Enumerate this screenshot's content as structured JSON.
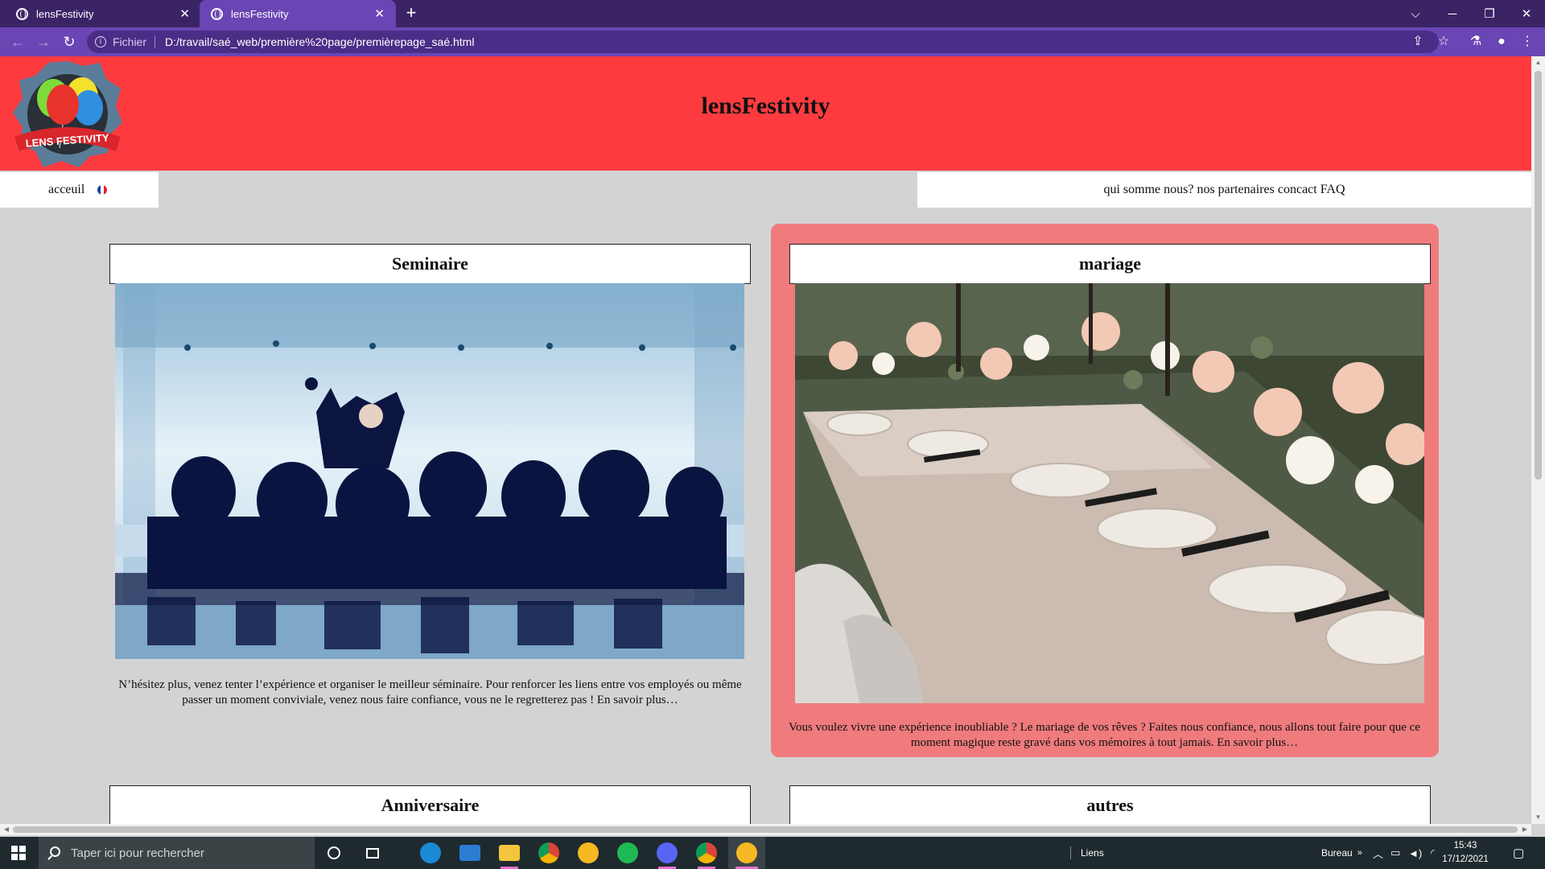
{
  "browser": {
    "tabs": [
      {
        "title": "lensFestivity",
        "active": false
      },
      {
        "title": "lensFestivity",
        "active": true
      }
    ],
    "new_tab": "+",
    "address": {
      "scheme_label": "Fichier",
      "url": "D:/travail/saé_web/première%20page/premièrepage_saé.html"
    }
  },
  "site": {
    "title": "lensFestivity",
    "logo_text": "LENS FESTIVITY",
    "nav_left": {
      "home": "acceuil"
    },
    "nav_right": [
      "qui somme nous?",
      "nos partenaires",
      "concact",
      "FAQ"
    ],
    "cards": [
      {
        "title": "Seminaire",
        "text": "N’hésitez plus, venez tenter l’expérience et organiser le meilleur séminaire. Pour renforcer les liens entre vos employés ou même passer un moment conviviale, venez nous faire confiance, vous ne le regretterez pas ! En savoir plus…"
      },
      {
        "title": "mariage",
        "text": "Vous voulez vivre une expérience inoubliable ? Le mariage de vos rêves ? Faites nous confiance, nous allons tout faire pour que ce moment magique reste gravé dans vos mémoires à tout jamais. En savoir plus…"
      },
      {
        "title": "Anniversaire"
      },
      {
        "title": "autres"
      }
    ]
  },
  "taskbar": {
    "search_placeholder": "Taper ici pour rechercher",
    "links_label": "Liens",
    "desktop_label": "Bureau",
    "time": "15:43",
    "date": "17/12/2021"
  },
  "colors": {
    "browser_dark": "#3b2466",
    "browser_accent": "#6a45b4",
    "site_header": "#fd3b3f",
    "highlight_card": "#ef7b7d",
    "page_bg": "#d3d3d3"
  }
}
